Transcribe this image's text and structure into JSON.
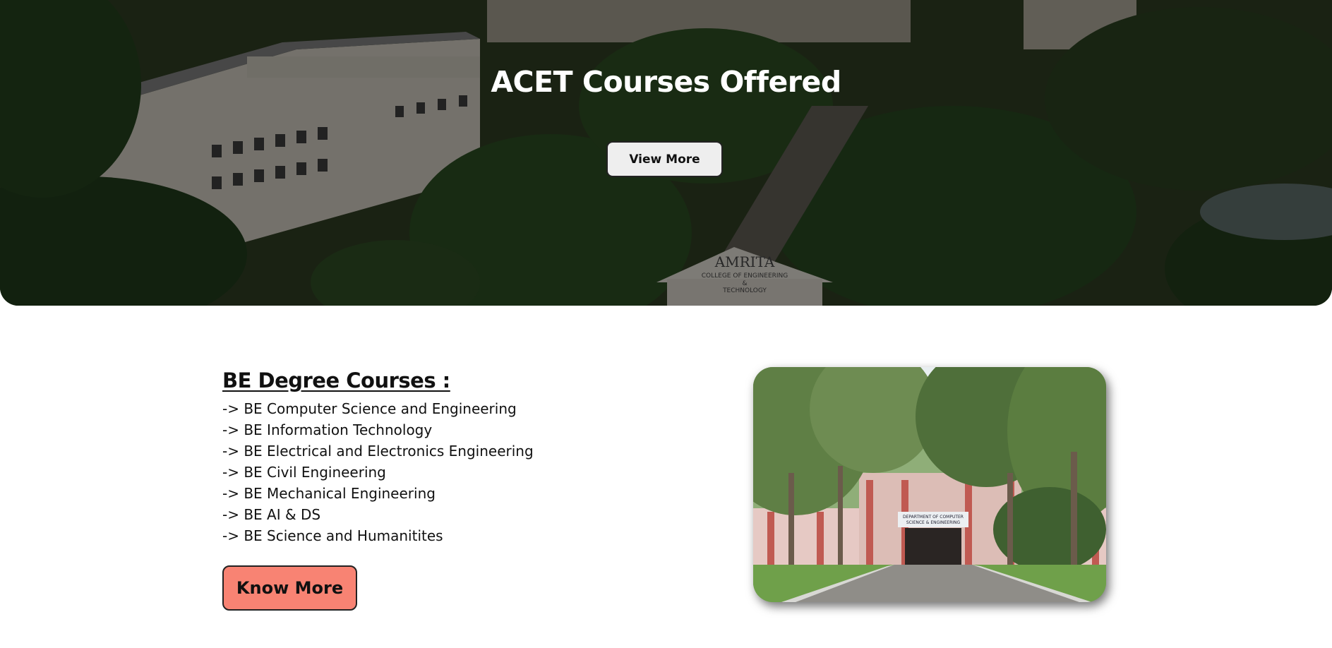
{
  "hero": {
    "title": "ACET Courses Offered",
    "view_more_label": "View More",
    "sign_lines": [
      "AMRITA",
      "COLLEGE OF ENGINEERING",
      "&",
      "TECHNOLOGY"
    ]
  },
  "courses": {
    "heading": "BE Degree Courses :",
    "items": [
      "-> BE Computer Science and Engineering",
      "-> BE Information Technology",
      "-> BE Electrical and Electronics Engineering",
      "-> BE Civil Engineering",
      "-> BE Mechanical Engineering",
      "-> BE AI & DS",
      "-> BE Science and Humanitites"
    ],
    "know_more_label": "Know More"
  },
  "photo": {
    "sign_lines": [
      "DEPARTMENT OF COMPUTER",
      "SCIENCE & ENGINEERING"
    ]
  },
  "colors": {
    "know_more_bg": "#f88373",
    "view_more_bg": "#eeeeee",
    "hero_overlay": "rgba(0,0,0,0.42)"
  }
}
